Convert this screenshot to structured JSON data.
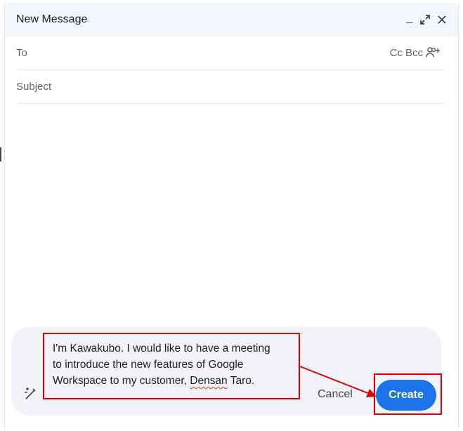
{
  "window": {
    "title": "New Message"
  },
  "header_buttons": {
    "minimize": "_",
    "expand": "⤢",
    "close": "✕"
  },
  "fields": {
    "to_label": "To",
    "cc_label": "Cc",
    "bcc_label": "Bcc",
    "subject_placeholder": "Subject"
  },
  "prompt": {
    "line1": "I'm Kawakubo. I would like to have a meeting",
    "line2": "to introduce the new features of Google",
    "line3_prefix": "Workspace to my customer, ",
    "line3_misspelled": "Densan",
    "line3_suffix": " Taro."
  },
  "actions": {
    "cancel_label": "Cancel",
    "create_label": "Create"
  },
  "colors": {
    "header_bg": "#f2f6fc",
    "panel_bg": "#f1f3f8",
    "accent": "#1a73e8",
    "annotation": "#e00000"
  },
  "icons": {
    "add_recipients": "people-add-icon",
    "help_me_write": "pen-sparkle-icon"
  }
}
